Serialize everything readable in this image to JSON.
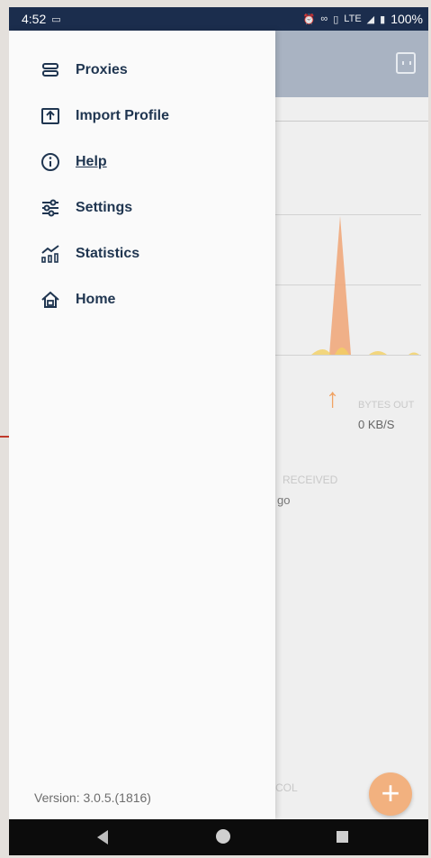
{
  "status_bar": {
    "time": "4:52",
    "battery": "100%",
    "network": "LTE"
  },
  "drawer": {
    "menu_items": [
      {
        "label": "Proxies",
        "icon": "server-list-icon"
      },
      {
        "label": "Import Profile",
        "icon": "import-upload-icon"
      },
      {
        "label": "Help",
        "icon": "info-icon"
      },
      {
        "label": "Settings",
        "icon": "sliders-icon"
      },
      {
        "label": "Statistics",
        "icon": "statistics-chart-icon"
      },
      {
        "label": "Home",
        "icon": "home-icon"
      }
    ],
    "version": "Version: 3.0.5.(1816)"
  },
  "background_app": {
    "bytes_out_label": "BYTES OUT",
    "bytes_out_value": "0 KB/S",
    "received_label": "RECEIVED",
    "received_value_fragment": "go",
    "col_fragment": "COL",
    "fab_symbol": "+"
  },
  "colors": {
    "status_bar": "#1b2d4d",
    "menu_text": "#1f3550",
    "accent": "#f2b17f"
  }
}
